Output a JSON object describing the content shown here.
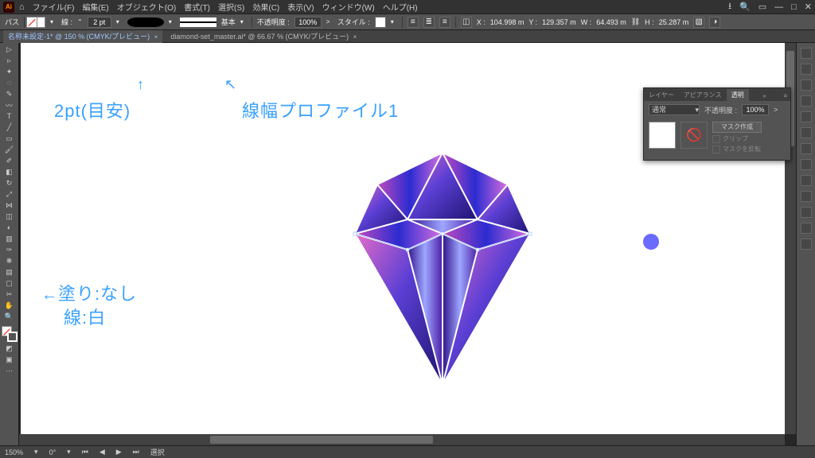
{
  "menu": {
    "items": [
      "ファイル(F)",
      "編集(E)",
      "オブジェクト(O)",
      "書式(T)",
      "選択(S)",
      "効果(C)",
      "表示(V)",
      "ウィンドウ(W)",
      "ヘルプ(H)"
    ]
  },
  "controlbar": {
    "context_label": "パス",
    "stroke_label": "線 :",
    "stroke_weight": "2 pt",
    "profile_label": "基本",
    "opacity_label": "不透明度 :",
    "opacity_value": "100%",
    "style_label": "スタイル :",
    "coords": {
      "x_label": "X :",
      "x": "104.998 m",
      "y_label": "Y :",
      "y": "129.357 m",
      "w_label": "W :",
      "w": "64.493 m",
      "h_label": "H :",
      "h": "25.287 m"
    }
  },
  "doctabs": {
    "tab1": "名称未設定-1* @ 150 % (CMYK/プレビュー)",
    "tab2": "diamond-set_master.ai* @ 66.67 % (CMYK/プレビュー)"
  },
  "annotations": {
    "a1": "2pt(目安)",
    "a2": "線幅プロファイル1",
    "a3_prefix": "←",
    "a3": "塗り:なし",
    "a4": "線:白"
  },
  "transparency_panel": {
    "tab_layer": "レイヤー",
    "tab_appearance": "アピアランス",
    "tab_transp": "透明",
    "blend_mode": "通常",
    "opacity_label": "不透明度 :",
    "opacity_value": "100%",
    "make_mask": "マスク作成",
    "clip": "クリップ",
    "invert": "マスクを反転"
  },
  "statusbar": {
    "zoom": "150%",
    "rotate": "0°",
    "tool": "選択"
  },
  "colors": {
    "annotation": "#39a0ff",
    "blue_dot": "#6b6bff"
  }
}
